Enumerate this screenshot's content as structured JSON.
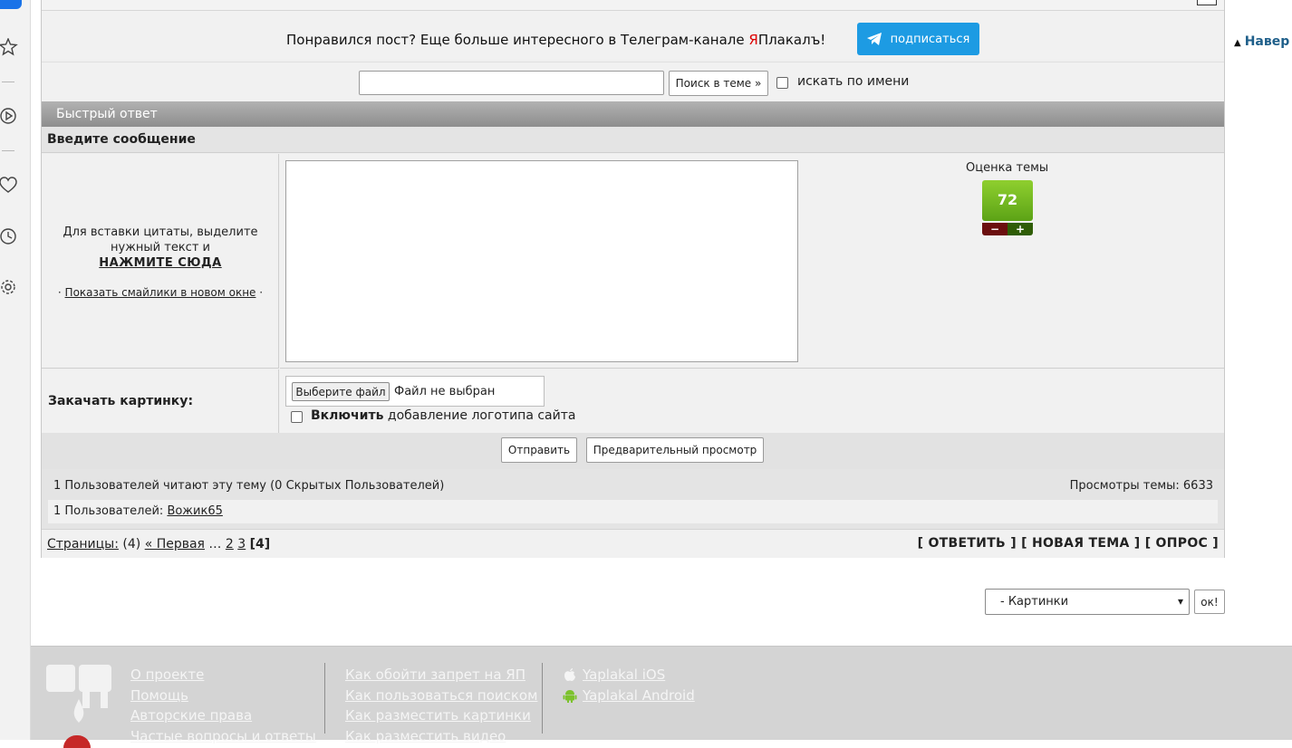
{
  "to_top": {
    "label": "Навер"
  },
  "telegram": {
    "text_before": "Понравился пост? Еще больше интересного в Телеграм-канале ",
    "brand_red": "Я",
    "brand_rest": "Плакалъ!",
    "subscribe_label": "подписаться"
  },
  "search": {
    "value": "",
    "button_label": "Поиск в теме »",
    "by_name_label": "искать по имени"
  },
  "quick_reply": {
    "header": "Быстрый ответ",
    "enter_message": "Введите сообщение",
    "quote_hint_1": "Для вставки цитаты, выделите",
    "quote_hint_2": "нужный текст и",
    "press_here": "НАЖМИТЕ СЮДА",
    "smiles_link": "Показать смайлики в новом окне",
    "message_value": ""
  },
  "rating": {
    "title": "Оценка темы",
    "value": "72",
    "minus": "−",
    "plus": "+"
  },
  "upload": {
    "label": "Закачать картинку:",
    "choose_file": "Выберите файл",
    "no_file": "Файл не выбран",
    "logo_bold": "Включить",
    "logo_rest": " добавление логотипа сайта"
  },
  "submit": {
    "send_label": "Отправить",
    "preview_label": "Предварительный просмотр"
  },
  "stats": {
    "readers": "1 Пользователей читают эту тему (0 Скрытых Пользователей)",
    "views": "Просмотры темы: 6633",
    "users_prefix": "1 Пользователей: ",
    "user_name": "Вожик65"
  },
  "pages": {
    "label": "Страницы:",
    "count": " (4) ",
    "first": "« Первая",
    "ellipsis": " … ",
    "p2": "2",
    "p3": "3",
    "current": "[4]"
  },
  "actions": {
    "reply": "[ ОТВЕТИТЬ ]",
    "new_topic": "[ НОВАЯ ТЕМА ]",
    "poll": "[ ОПРОС ]"
  },
  "category": {
    "selected": "- Картинки",
    "ok_label": "ок!"
  },
  "footer": {
    "col1": [
      "О проекте",
      "Помощь",
      "Авторские права",
      "Частые вопросы и ответы"
    ],
    "col2": [
      "Как обойти запрет на ЯП",
      "Как пользоваться поиском",
      "Как разместить картинки",
      "Как разместить видео"
    ],
    "ios": "Yaplakal iOS",
    "android": "Yaplakal Android"
  },
  "colors": {
    "telegram_button": "#1d9be3",
    "rating_green": "#6fb81f",
    "brand_red": "#dd0000"
  }
}
